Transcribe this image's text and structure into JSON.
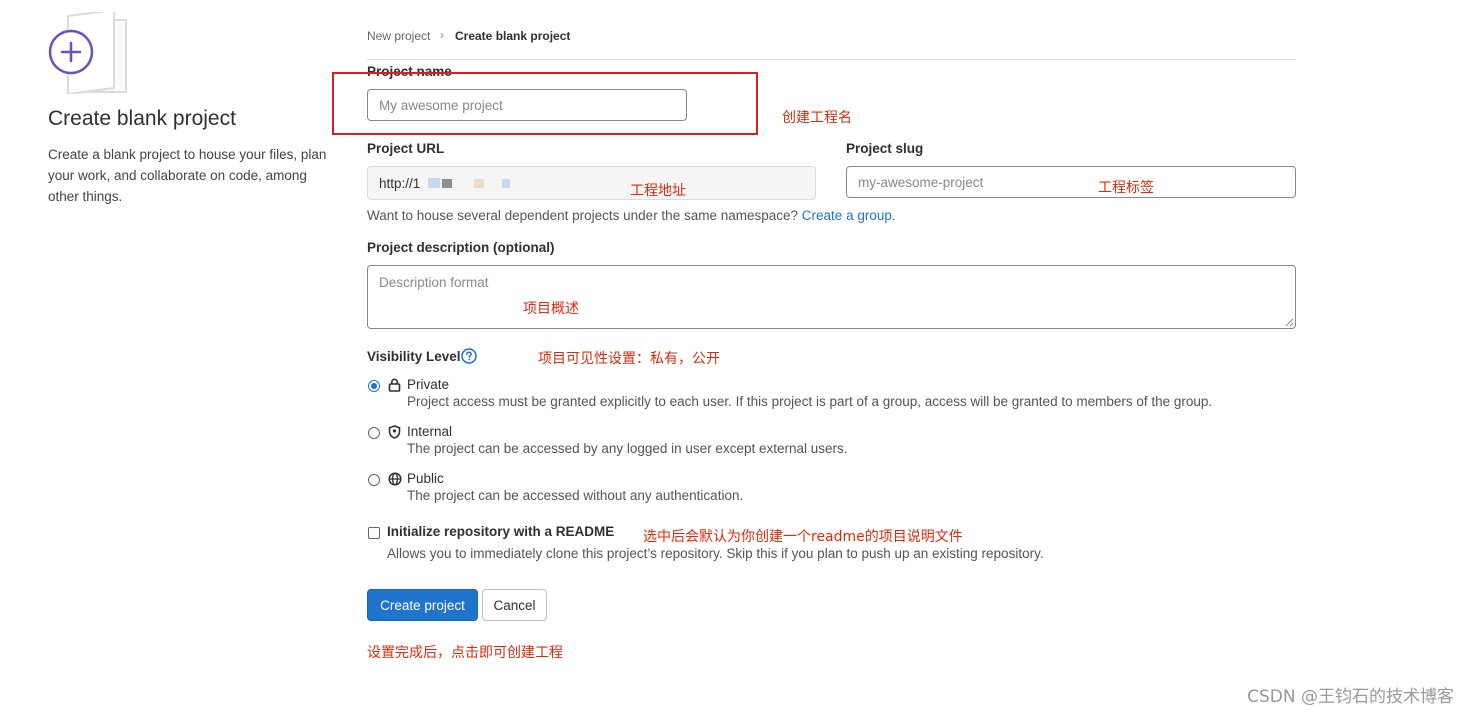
{
  "breadcrumb": {
    "parent": "New project",
    "current": "Create blank project"
  },
  "left": {
    "title": "Create blank project",
    "description": "Create a blank project to house your files, plan your work, and collaborate on code, among other things."
  },
  "form": {
    "project_name": {
      "label": "Project name",
      "placeholder": "My awesome project"
    },
    "project_url": {
      "label": "Project URL",
      "value": "http://1"
    },
    "project_slug": {
      "label": "Project slug",
      "placeholder": "my-awesome-project"
    },
    "group_hint": {
      "text": "Want to house several dependent projects under the same namespace?",
      "link": "Create a group."
    },
    "description": {
      "label": "Project description (optional)",
      "placeholder": "Description format"
    },
    "visibility": {
      "label": "Visibility Level",
      "options": [
        {
          "title": "Private",
          "desc": "Project access must be granted explicitly to each user. If this project is part of a group, access will be granted to members of the group.",
          "selected": true
        },
        {
          "title": "Internal",
          "desc": "The project can be accessed by any logged in user except external users.",
          "selected": false
        },
        {
          "title": "Public",
          "desc": "The project can be accessed without any authentication.",
          "selected": false
        }
      ]
    },
    "readme": {
      "label": "Initialize repository with a README",
      "desc": "Allows you to immediately clone this project’s repository. Skip this if you plan to push up an existing repository.",
      "checked": false
    },
    "buttons": {
      "create": "Create project",
      "cancel": "Cancel"
    }
  },
  "annotations": {
    "name": "创建工程名",
    "url": "工程地址",
    "slug": "工程标签",
    "description": "项目概述",
    "visibility": "项目可见性设置：私有，公开",
    "readme": "选中后会默认为你创建一个readme的项目说明文件",
    "done": "设置完成后，点击即可创建工程"
  },
  "watermark": "CSDN @王钧石的技术博客",
  "colors": {
    "primary": "#1f75cb",
    "annotation": "#dd2b0e",
    "illustration": "#6b4fbb"
  }
}
